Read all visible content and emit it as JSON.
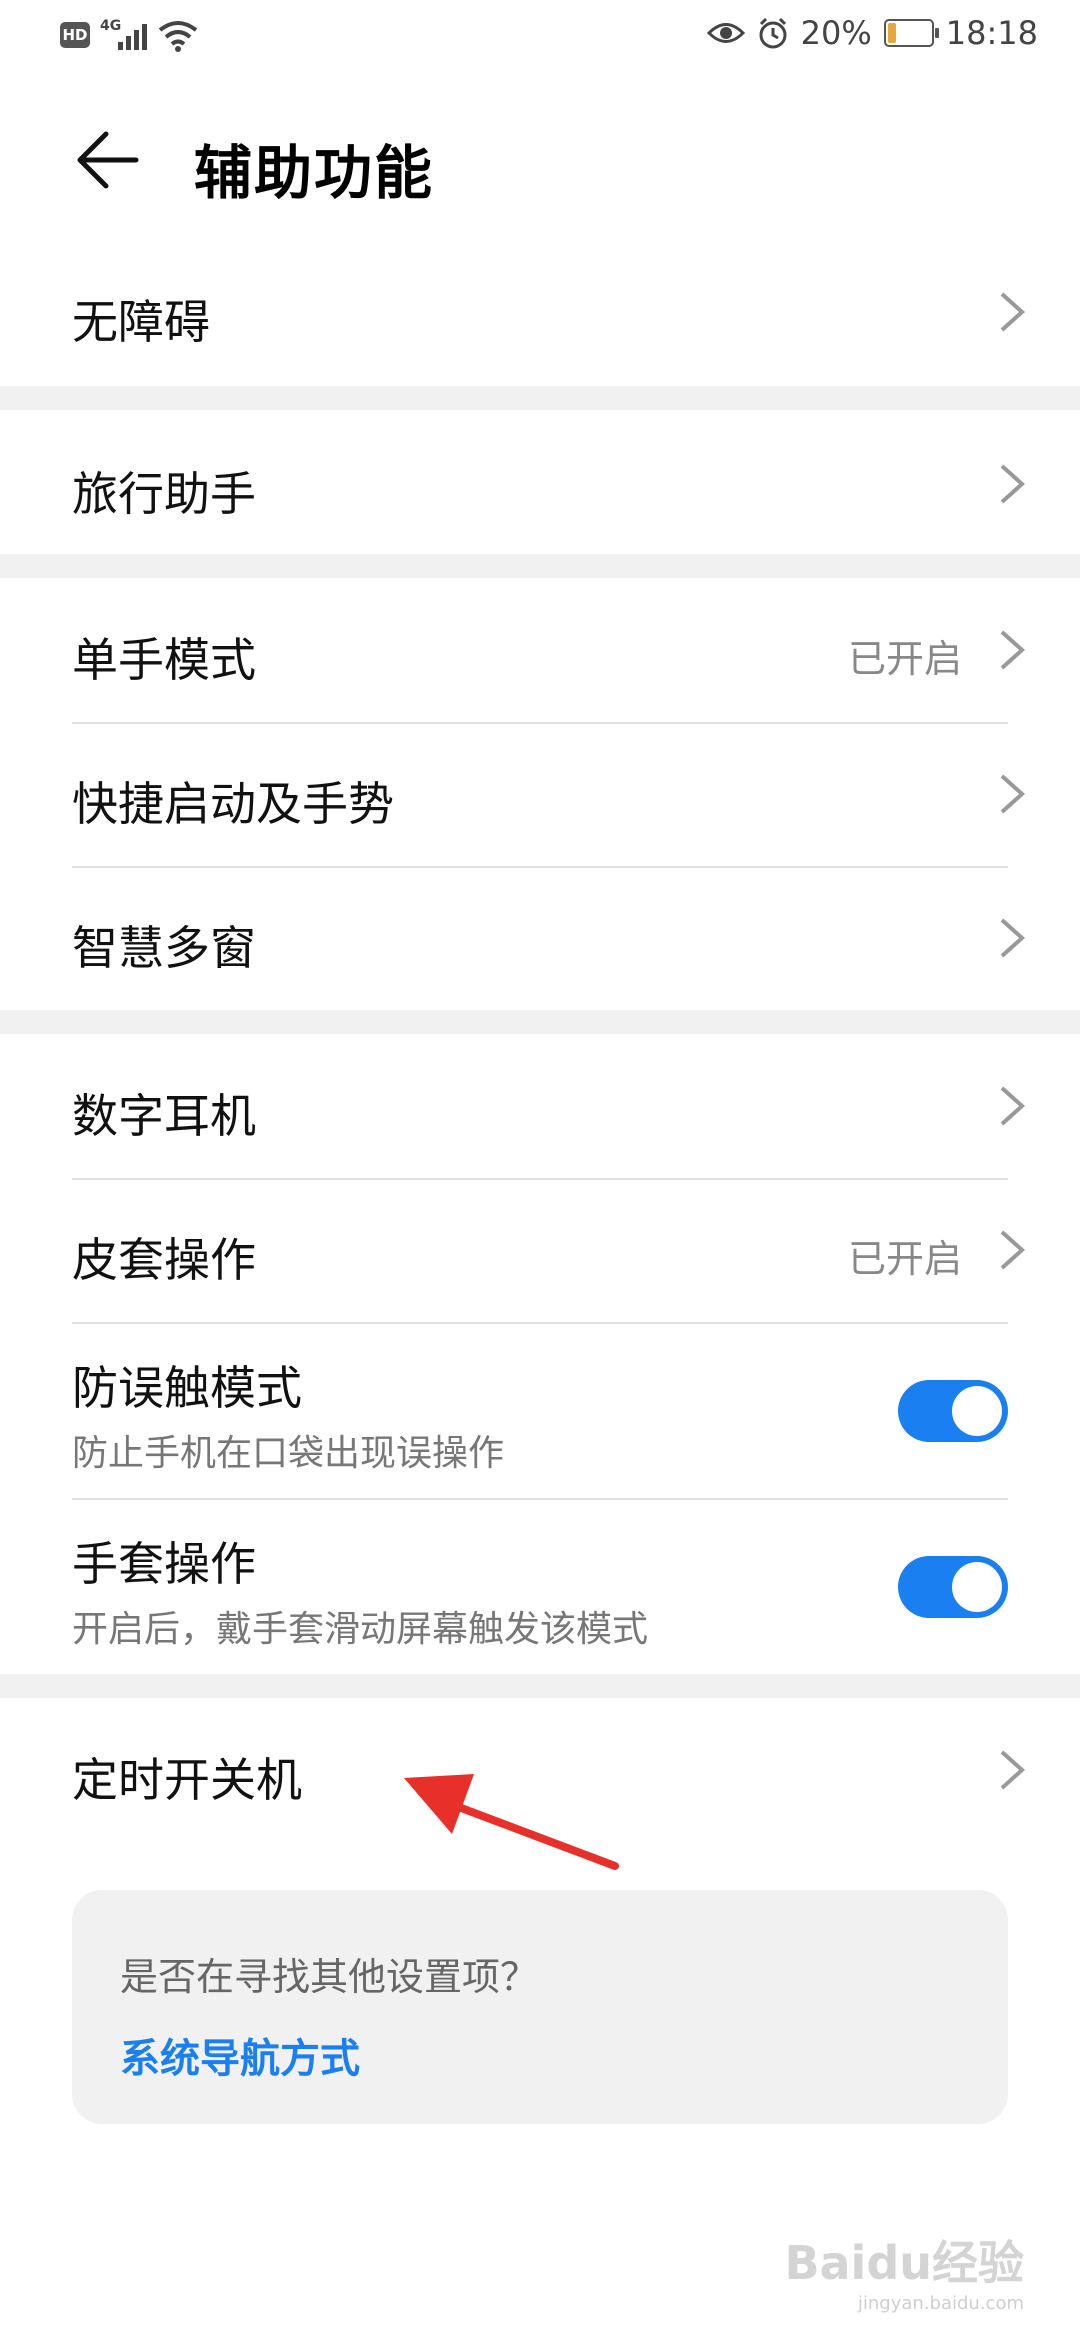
{
  "status_bar": {
    "hd_badge": "HD",
    "network": "4G",
    "battery_percent": "20%",
    "battery_level": 0.2,
    "time": "18:18",
    "icons": [
      "signal-icon",
      "wifi-icon",
      "eye-icon",
      "alarm-icon",
      "battery-icon"
    ]
  },
  "header": {
    "title": "辅助功能",
    "back_icon": "arrow-left-icon"
  },
  "items": [
    {
      "label": "无障碍"
    },
    {
      "label": "旅行助手"
    },
    {
      "label": "单手模式",
      "value": "已开启"
    },
    {
      "label": "快捷启动及手势"
    },
    {
      "label": "智慧多窗"
    },
    {
      "label": "数字耳机"
    },
    {
      "label": "皮套操作",
      "value": "已开启"
    },
    {
      "label": "防误触模式",
      "sub": "防止手机在口袋出现误操作",
      "toggle_on": true
    },
    {
      "label": "手套操作",
      "sub": "开启后，戴手套滑动屏幕触发该模式",
      "toggle_on": true
    },
    {
      "label": "定时开关机"
    }
  ],
  "suggestion_card": {
    "question": "是否在寻找其他设置项？",
    "link": "系统导航方式"
  },
  "annotation": {
    "arrow_color": "#e8302a"
  },
  "watermark": {
    "text": "Baidu经验",
    "url": "jingyan.baidu.com"
  },
  "colors": {
    "accent": "#1a7ff0",
    "divider": "#e3e3e3",
    "section_gap": "#f1f1f1"
  }
}
